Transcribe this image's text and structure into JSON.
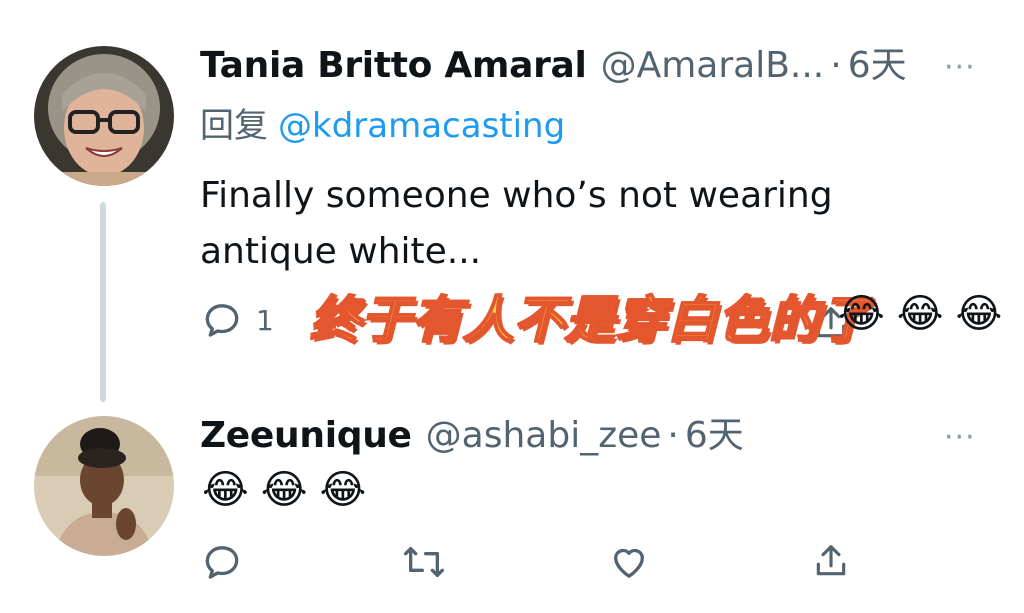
{
  "tweet1": {
    "display_name": "Tania Britto Amaral",
    "handle": "@AmaralB...",
    "dot": "·",
    "time": "6天",
    "more": "···",
    "reply_prefix": "回复",
    "reply_mention": "@kdramacasting",
    "text": "Finally someone who’s not wearing antique white...",
    "reply_count": "1"
  },
  "caption": {
    "text": "终于有人不是穿白色的了",
    "emojis": [
      "😂",
      "😂",
      "😂"
    ]
  },
  "tweet2": {
    "display_name": "Zeeunique",
    "handle": "@ashabi_zee",
    "dot": "·",
    "time": "6天",
    "more": "···",
    "emojis": [
      "😂",
      "😂",
      "😂"
    ]
  },
  "icons": {
    "reply": "reply-icon",
    "retweet": "retweet-icon",
    "like": "heart-icon",
    "share": "share-icon",
    "more": "more-icon"
  },
  "colors": {
    "text_primary": "#0f1419",
    "text_secondary": "#536471",
    "mention": "#1d9bf0",
    "thread_line": "#cfd9de",
    "caption_fill": "#ffd23f",
    "caption_stroke": "#e4572e"
  }
}
